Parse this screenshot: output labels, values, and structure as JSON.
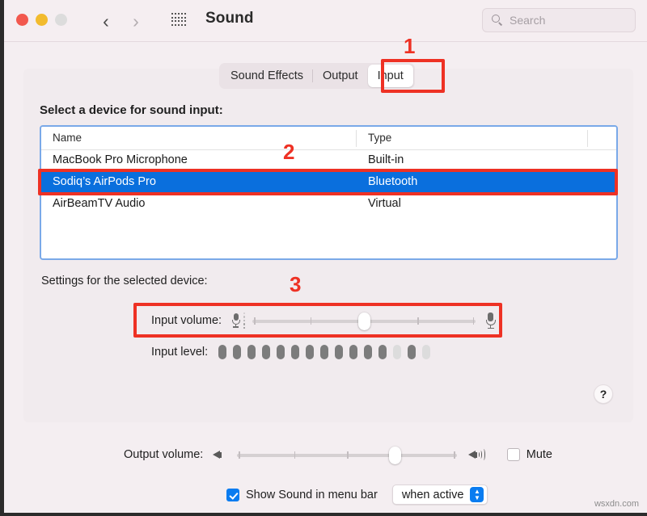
{
  "window": {
    "title": "Sound",
    "traffic_lights": [
      "close-red",
      "minimize-yellow",
      "maximize-gray"
    ],
    "back_icon": "‹",
    "forward_icon": "›",
    "grid_icon": "apps-grid-icon"
  },
  "search": {
    "placeholder": "Search",
    "value": "",
    "icon": "search-icon"
  },
  "tabs": [
    {
      "label": "Sound Effects",
      "active": false
    },
    {
      "label": "Output",
      "active": false
    },
    {
      "label": "Input",
      "active": true
    }
  ],
  "main": {
    "select_device_label": "Select a device for sound input:",
    "settings_label": "Settings for the selected device:",
    "help_label": "?"
  },
  "device_table": {
    "columns": [
      "Name",
      "Type",
      ""
    ],
    "rows": [
      {
        "name": "MacBook Pro Microphone",
        "type": "Built-in",
        "selected": false
      },
      {
        "name": "Sodiq’s AirPods Pro",
        "type": "Bluetooth",
        "selected": true
      },
      {
        "name": "AirBeamTV Audio",
        "type": "Virtual",
        "selected": false
      }
    ]
  },
  "input_volume": {
    "label": "Input volume:",
    "value_percent": 50,
    "left_icon": "microphone-small-icon",
    "right_icon": "microphone-large-icon"
  },
  "input_level": {
    "label": "Input level:",
    "segments_total": 15,
    "segments_lit": 12,
    "pattern": [
      1,
      1,
      1,
      1,
      1,
      1,
      1,
      1,
      1,
      1,
      1,
      1,
      0,
      1,
      0
    ]
  },
  "output_volume": {
    "label": "Output volume:",
    "value_percent": 72,
    "left_icon": "speaker-mute-icon",
    "right_icon": "speaker-loud-icon",
    "mute_label": "Mute",
    "mute_checked": false
  },
  "menu_bar_option": {
    "checkbox_label": "Show Sound in menu bar",
    "checked": true,
    "select_value": "when active",
    "select_icon": "chevron-updown-icon"
  },
  "annotations": [
    {
      "number": "1",
      "target": "input-tab"
    },
    {
      "number": "2",
      "target": "selected-device-row"
    },
    {
      "number": "3",
      "target": "input-volume-slider"
    }
  ],
  "watermark": "wsxdn.com",
  "colors": {
    "accent_blue": "#0a6fdd",
    "annotation_red": "#ee3124",
    "titlebar_bg": "#f5eef1",
    "panel_bg": "#f1ebee"
  }
}
